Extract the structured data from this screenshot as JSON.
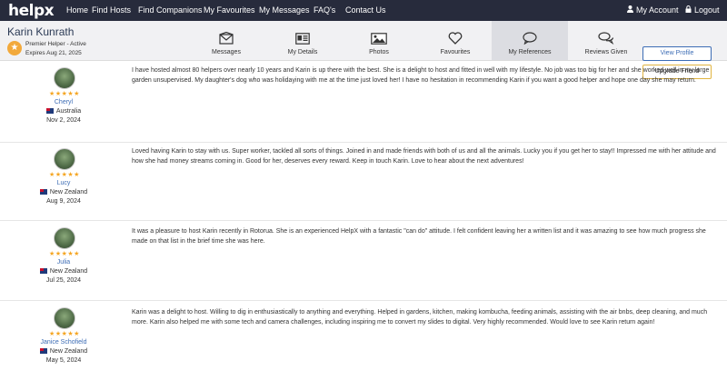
{
  "nav": {
    "logo": "helpx",
    "items": [
      "Home",
      "Find Hosts",
      "Find Companions",
      "My Favourites",
      "My Messages",
      "FAQ's",
      "Contact Us"
    ],
    "account": "My Account",
    "logout": "Logout"
  },
  "profile": {
    "name": "Karin Kunrath",
    "type": "Premier Helper - Active",
    "expires": "Expires Aug 21, 2025"
  },
  "tabs": [
    {
      "label": "Messages",
      "icon": "envelope-icon"
    },
    {
      "label": "My Details",
      "icon": "id-card-icon"
    },
    {
      "label": "Photos",
      "icon": "photo-icon"
    },
    {
      "label": "Favourites",
      "icon": "heart-icon"
    },
    {
      "label": "My References",
      "icon": "chat-bubble-icon",
      "active": true
    },
    {
      "label": "Reviews Given",
      "icon": "chat-bubbles-icon"
    }
  ],
  "buttons": {
    "view_profile": "View Profile",
    "upgrade_friend": "Upgrade Friend"
  },
  "reviews": [
    {
      "name": "Cheryl",
      "stars": "★★★★★",
      "country": "Australia",
      "date": "Nov 2, 2024",
      "text": "I have hosted almost 80 helpers over nearly 10 years and Karin is up there with the best. She is a delight to host and fitted in well with my lifestyle. No job was too big for her and she worked well in my large garden unsupervised. My daughter's dog who was holidaying with me at the time just loved her! I have no hesitation in recommending Karin if you want a good helper and hope one day she may return."
    },
    {
      "name": "Lucy",
      "stars": "★★★★★",
      "country": "New Zealand",
      "date": "Aug 9, 2024",
      "text": "Loved having Karin to stay with us. Super worker, tackled all sorts of things. Joined in and made friends with both of us and all the animals. Lucky you if you get her to stay!! Impressed me with her attitude and how she had money streams coming in. Good for her, deserves every reward. Keep in touch Karin. Love to hear about the next adventures!"
    },
    {
      "name": "Julia",
      "stars": "★★★★★",
      "country": "New Zealand",
      "date": "Jul 25, 2024",
      "text": "It was a pleasure to host Karin recently in Rotorua. She is an experienced HelpX with a fantastic \"can do\" attitude. I felt confident leaving her a written list and it was amazing to see how much progress she made on that list in the brief time she was here."
    },
    {
      "name": "Janice Schofield",
      "stars": "★★★★★",
      "country": "New Zealand",
      "date": "May 5, 2024",
      "text": "Karin was a delight to host. Willing to dig in enthusiastically to anything and everything. Helped in gardens, kitchen, making kombucha, feeding animals, assisting with the air bnbs, deep cleaning, and much more. Karin also helped me with some tech and camera challenges, including inspiring me to convert my slides to digital. Very highly recommended. Would love to see Karin return again!"
    }
  ]
}
